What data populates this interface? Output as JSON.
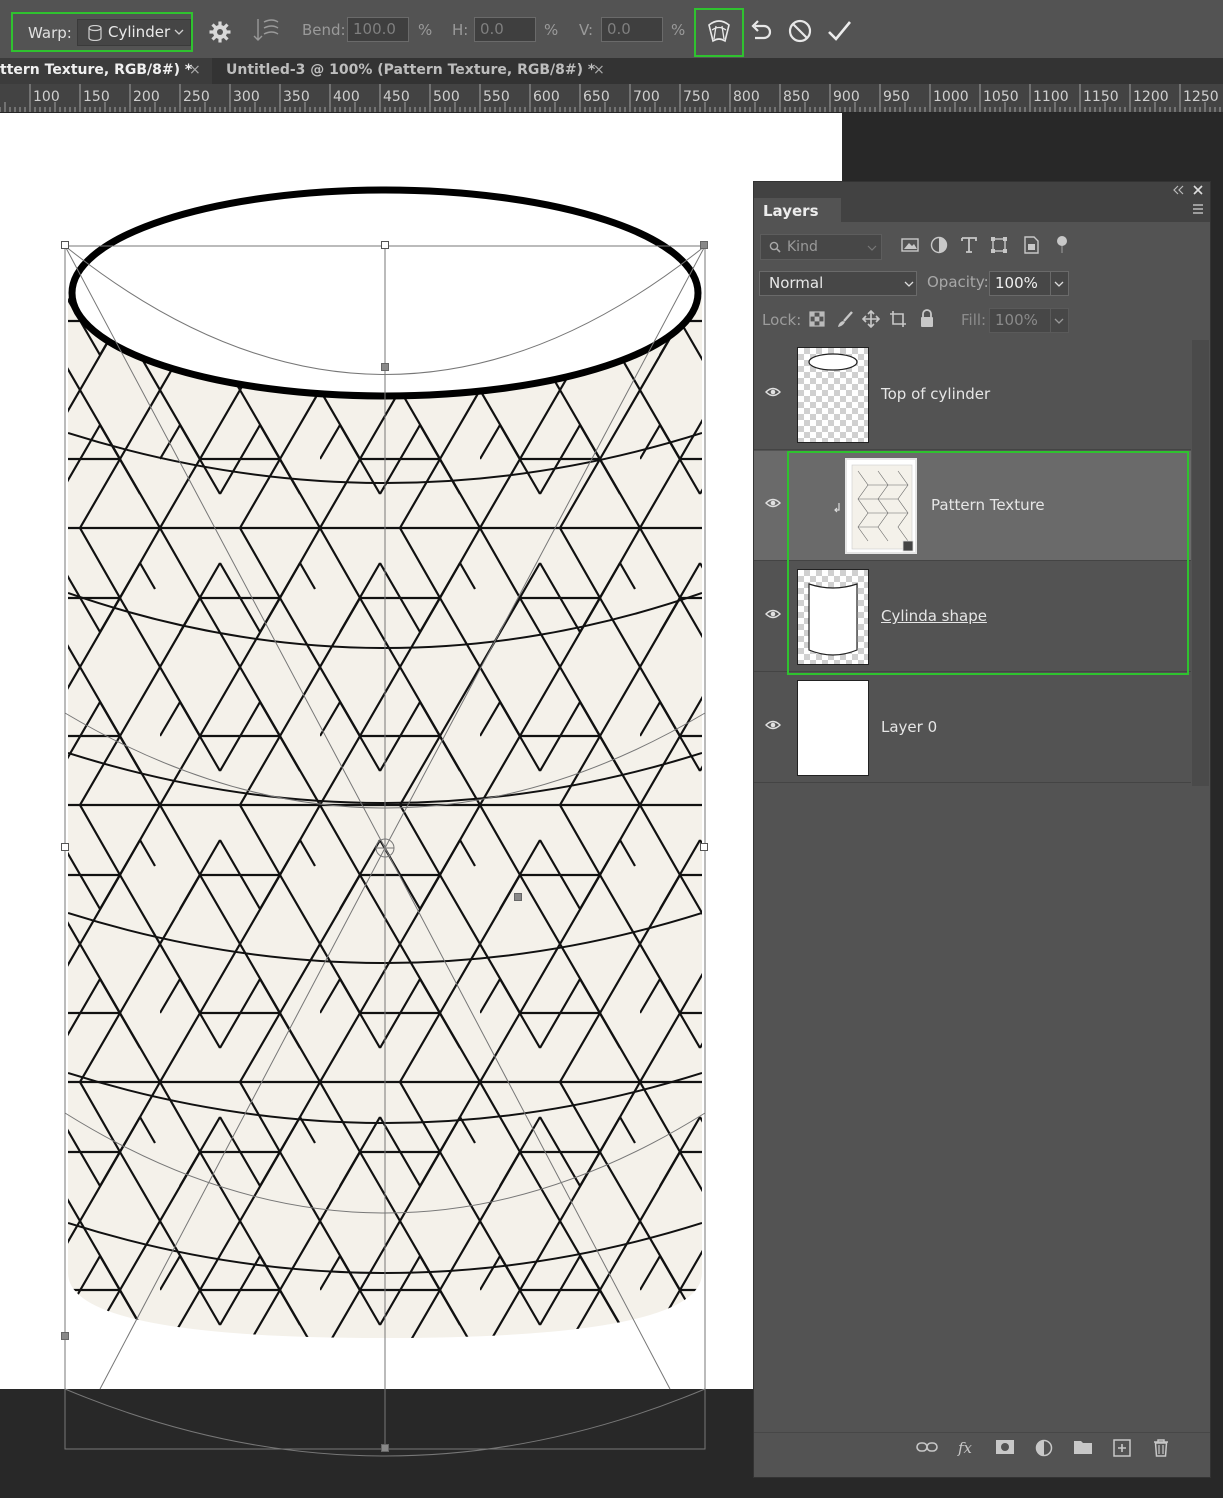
{
  "options_bar": {
    "warp_label": "Warp:",
    "warp_value": "Cylinder",
    "bend_label": "Bend:",
    "bend_value": "100.0",
    "h_label": "H:",
    "h_value": "0.0",
    "v_label": "V:",
    "v_value": "0.0",
    "percent": "%",
    "icons": [
      "cylinder-icon",
      "gear-icon",
      "warp-orientation-icon",
      "warp-toggle-icon",
      "undo-icon",
      "cancel-icon",
      "commit-check-icon"
    ]
  },
  "tabs": [
    {
      "label": "ttern Texture, RGB/8#) *",
      "close": "×"
    },
    {
      "label": "Untitled-3 @ 100% (Pattern Texture, RGB/8#) *",
      "close": "×"
    }
  ],
  "ruler": {
    "ticks": [
      "100",
      "150",
      "200",
      "250",
      "300",
      "350",
      "400",
      "450",
      "500",
      "550",
      "600",
      "650",
      "700",
      "750",
      "800",
      "850",
      "900",
      "950",
      "1000",
      "1050",
      "1100",
      "1150",
      "1200",
      "1250"
    ]
  },
  "layers_panel": {
    "title": "Layers",
    "kind_placeholder": "Kind",
    "blend_mode": "Normal",
    "opacity_label": "Opacity:",
    "opacity_value": "100%",
    "lock_label": "Lock:",
    "fill_label": "Fill:",
    "fill_value": "100%",
    "layers": [
      {
        "name": "Top of cylinder",
        "selected": false
      },
      {
        "name": "Pattern Texture",
        "selected": true
      },
      {
        "name": "Cylinda shape ",
        "selected": false
      },
      {
        "name": "Layer 0",
        "selected": false
      }
    ]
  },
  "colors": {
    "highlight": "#2fc22f",
    "panel": "#535353",
    "bar": "#535353",
    "canvas_bg": "#282828"
  }
}
